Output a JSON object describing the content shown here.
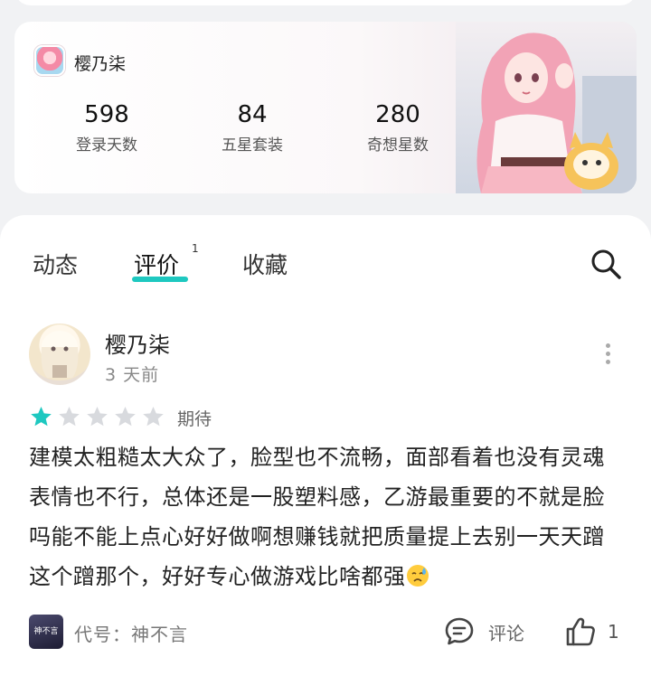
{
  "game_card": {
    "app_name": "樱乃柒",
    "app_icon": "game-app-icon",
    "stats": [
      {
        "value": "598",
        "label": "登录天数"
      },
      {
        "value": "84",
        "label": "五星套装"
      },
      {
        "value": "280",
        "label": "奇想星数"
      }
    ]
  },
  "tabs": {
    "dynamic": "动态",
    "review": "评价",
    "review_count": "1",
    "favorites": "收藏",
    "active": "评价",
    "accent_color": "#1ec8c0"
  },
  "review": {
    "username": "樱乃柒",
    "time": "3 天前",
    "rating": 1,
    "rating_max": 5,
    "star_filled_color": "#1ec8c0",
    "star_empty_color": "#d8dade",
    "rating_label": "期待",
    "text": "建模太粗糙太大众了，脸型也不流畅，面部看着也没有灵魂表情也不行，总体还是一股塑料感，乙游最重要的不就是脸吗能不能上点心好好做啊想赚钱就把质量提上去别一天天蹭这个蹭那个，好好专心做游戏比啥都强",
    "device_icon_text": "神不言",
    "device_label": "代号：神不言",
    "comment_label": "评论",
    "like_count": "1"
  }
}
